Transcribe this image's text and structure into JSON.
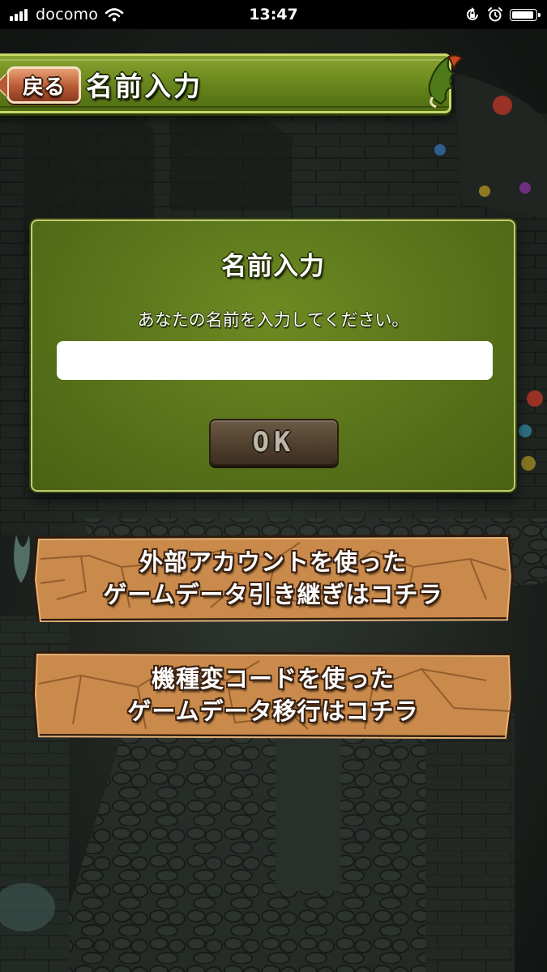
{
  "status_bar": {
    "carrier": "docomo",
    "time": "13:47",
    "icons": [
      "signal-icon",
      "wifi-icon",
      "rotation-lock-icon",
      "alarm-icon",
      "battery-icon"
    ]
  },
  "header": {
    "back_label": "戻る",
    "title": "名前入力"
  },
  "dialog": {
    "title": "名前入力",
    "message": "あなたの名前を入力してください。",
    "input_value": "",
    "ok_label": "OK"
  },
  "actions": [
    {
      "line1": "外部アカウントを使った",
      "line2": "ゲームデータ引き継ぎはコチラ"
    },
    {
      "line1": "機種変コードを使った",
      "line2": "ゲームデータ移行はコチラ"
    }
  ],
  "colors": {
    "header_green": "#6c8a1e",
    "dialog_green": "#58731a",
    "back_button": "#b85a35",
    "stone_button": "#c98a4b",
    "ok_button": "#4e3e2c"
  }
}
